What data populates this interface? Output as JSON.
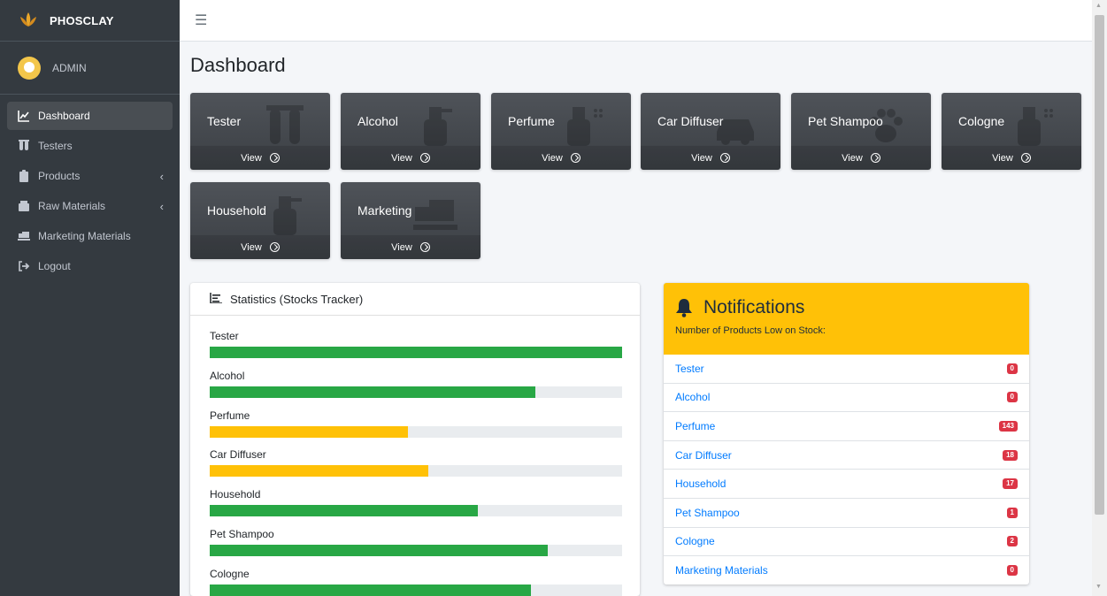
{
  "brand": {
    "name": "PHOSCLAY"
  },
  "user": {
    "name": "ADMIN"
  },
  "sidebar": {
    "items": [
      {
        "label": "Dashboard",
        "icon": "chart-line-icon",
        "active": true,
        "has_children": false
      },
      {
        "label": "Testers",
        "icon": "vials-icon",
        "active": false,
        "has_children": false
      },
      {
        "label": "Products",
        "icon": "clipboard-icon",
        "active": false,
        "has_children": true
      },
      {
        "label": "Raw Materials",
        "icon": "boxes-icon",
        "active": false,
        "has_children": true
      },
      {
        "label": "Marketing Materials",
        "icon": "dolly-icon",
        "active": false,
        "has_children": false
      },
      {
        "label": "Logout",
        "icon": "sign-out-icon",
        "active": false,
        "has_children": false
      }
    ]
  },
  "page": {
    "title": "Dashboard"
  },
  "tiles": [
    {
      "title": "Tester",
      "link": "View",
      "icon": "vials-icon"
    },
    {
      "title": "Alcohol",
      "link": "View",
      "icon": "spray-bottle-icon"
    },
    {
      "title": "Perfume",
      "link": "View",
      "icon": "spray-bottle-icon"
    },
    {
      "title": "Car Diffuser",
      "link": "View",
      "icon": "car-icon"
    },
    {
      "title": "Pet Shampoo",
      "link": "View",
      "icon": "paw-icon"
    },
    {
      "title": "Cologne",
      "link": "View",
      "icon": "spray-bottle-icon"
    },
    {
      "title": "Household",
      "link": "View",
      "icon": "spray-bottle-icon"
    },
    {
      "title": "Marketing",
      "link": "View",
      "icon": "dolly-icon"
    }
  ],
  "stats": {
    "title": "Statistics (Stocks Tracker)",
    "rows": [
      {
        "label": "Tester",
        "percent": 100,
        "color": "#28a745"
      },
      {
        "label": "Alcohol",
        "percent": 79,
        "color": "#28a745"
      },
      {
        "label": "Perfume",
        "percent": 48,
        "color": "#ffc107"
      },
      {
        "label": "Car Diffuser",
        "percent": 53,
        "color": "#ffc107"
      },
      {
        "label": "Household",
        "percent": 65,
        "color": "#28a745"
      },
      {
        "label": "Pet Shampoo",
        "percent": 82,
        "color": "#28a745"
      },
      {
        "label": "Cologne",
        "percent": 78,
        "color": "#28a745"
      }
    ]
  },
  "notifications": {
    "title": "Notifications",
    "subtitle": "Number of Products Low on Stock:",
    "items": [
      {
        "label": "Tester",
        "count": "0"
      },
      {
        "label": "Alcohol",
        "count": "0"
      },
      {
        "label": "Perfume",
        "count": "143"
      },
      {
        "label": "Car Diffuser",
        "count": "18"
      },
      {
        "label": "Household",
        "count": "17"
      },
      {
        "label": "Pet Shampoo",
        "count": "1"
      },
      {
        "label": "Cologne",
        "count": "2"
      },
      {
        "label": "Marketing Materials",
        "count": "0"
      }
    ]
  },
  "colors": {
    "sidebar": "#343a40",
    "accent": "#ffc107",
    "success": "#28a745",
    "danger": "#dc3545",
    "link": "#007bff"
  }
}
